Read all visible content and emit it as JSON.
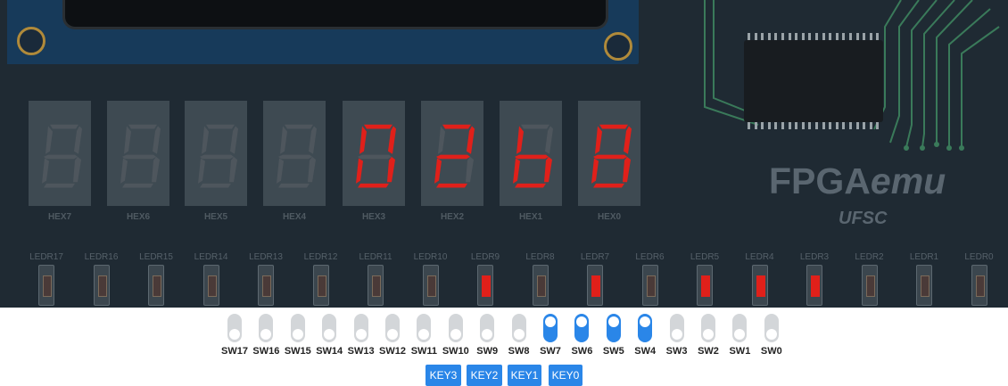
{
  "brand": {
    "name_main": "FPGA",
    "name_emu": "emu",
    "org": "UFSC"
  },
  "colors": {
    "board": "#1f2a33",
    "segment_on": "#e0201a",
    "segment_off": "#4e565d",
    "accent": "#2a86e8"
  },
  "displays": [
    {
      "label": "HEX7",
      "segments": ""
    },
    {
      "label": "HEX6",
      "segments": ""
    },
    {
      "label": "HEX5",
      "segments": ""
    },
    {
      "label": "HEX4",
      "segments": ""
    },
    {
      "label": "HEX3",
      "segments": "abcdef"
    },
    {
      "label": "HEX2",
      "segments": "abdeg"
    },
    {
      "label": "HEX1",
      "segments": "cdefg"
    },
    {
      "label": "HEX0",
      "segments": "abcdefg"
    }
  ],
  "leds": [
    {
      "label": "LEDR17",
      "on": false
    },
    {
      "label": "LEDR16",
      "on": false
    },
    {
      "label": "LEDR15",
      "on": false
    },
    {
      "label": "LEDR14",
      "on": false
    },
    {
      "label": "LEDR13",
      "on": false
    },
    {
      "label": "LEDR12",
      "on": false
    },
    {
      "label": "LEDR11",
      "on": false
    },
    {
      "label": "LEDR10",
      "on": false
    },
    {
      "label": "LEDR9",
      "on": true
    },
    {
      "label": "LEDR8",
      "on": false
    },
    {
      "label": "LEDR7",
      "on": true
    },
    {
      "label": "LEDR6",
      "on": false
    },
    {
      "label": "LEDR5",
      "on": true
    },
    {
      "label": "LEDR4",
      "on": true
    },
    {
      "label": "LEDR3",
      "on": true
    },
    {
      "label": "LEDR2",
      "on": false
    },
    {
      "label": "LEDR1",
      "on": false
    },
    {
      "label": "LEDR0",
      "on": false
    }
  ],
  "switches": [
    {
      "label": "SW17",
      "on": false
    },
    {
      "label": "SW16",
      "on": false
    },
    {
      "label": "SW15",
      "on": false
    },
    {
      "label": "SW14",
      "on": false
    },
    {
      "label": "SW13",
      "on": false
    },
    {
      "label": "SW12",
      "on": false
    },
    {
      "label": "SW11",
      "on": false
    },
    {
      "label": "SW10",
      "on": false
    },
    {
      "label": "SW9",
      "on": false
    },
    {
      "label": "SW8",
      "on": false
    },
    {
      "label": "SW7",
      "on": true
    },
    {
      "label": "SW6",
      "on": true
    },
    {
      "label": "SW5",
      "on": true
    },
    {
      "label": "SW4",
      "on": true
    },
    {
      "label": "SW3",
      "on": false
    },
    {
      "label": "SW2",
      "on": false
    },
    {
      "label": "SW1",
      "on": false
    },
    {
      "label": "SW0",
      "on": false
    }
  ],
  "keys": [
    {
      "label": "KEY3"
    },
    {
      "label": "KEY2"
    },
    {
      "label": "KEY1"
    },
    {
      "label": "KEY0"
    }
  ]
}
